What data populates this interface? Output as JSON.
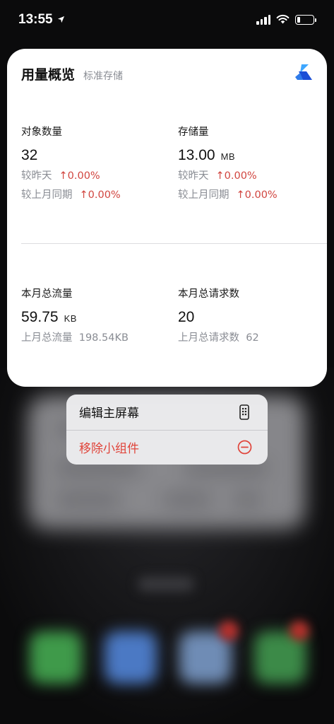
{
  "status_bar": {
    "time": "13:55",
    "location_icon": "location-arrow-icon",
    "signal_icon": "cellular-signal-icon",
    "wifi_icon": "wifi-icon",
    "battery_icon": "battery-low-icon",
    "battery_level": 0.12
  },
  "widget": {
    "title": "用量概览",
    "subtitle": "标准存储",
    "logo_icon": "app-logo-icon",
    "colors": {
      "logo_light": "#3ea7ff",
      "logo_dark": "#1b4fd6",
      "increase": "#d1453f",
      "muted": "#8a8d94"
    },
    "metrics": {
      "object_count": {
        "label": "对象数量",
        "value": "32",
        "day_label": "较昨天",
        "day_change": "↑0.00%",
        "month_label": "较上月同期",
        "month_change": "↑0.00%"
      },
      "storage": {
        "label": "存储量",
        "value": "13.00",
        "unit": "MB",
        "day_label": "较昨天",
        "day_change": "↑0.00%",
        "month_label": "较上月同期",
        "month_change": "↑0.00%"
      },
      "monthly_traffic": {
        "label": "本月总流量",
        "value": "59.75",
        "unit": "KB",
        "last_label": "上月总流量",
        "last_value": "198.54KB"
      },
      "monthly_requests": {
        "label": "本月总请求数",
        "value": "20",
        "last_label": "上月总请求数",
        "last_value": "62"
      }
    }
  },
  "context_menu": {
    "items": [
      {
        "label": "编辑主屏幕",
        "icon": "phone-screen-icon",
        "destructive": false
      },
      {
        "label": "移除小组件",
        "icon": "minus-circle-icon",
        "destructive": true
      }
    ]
  }
}
